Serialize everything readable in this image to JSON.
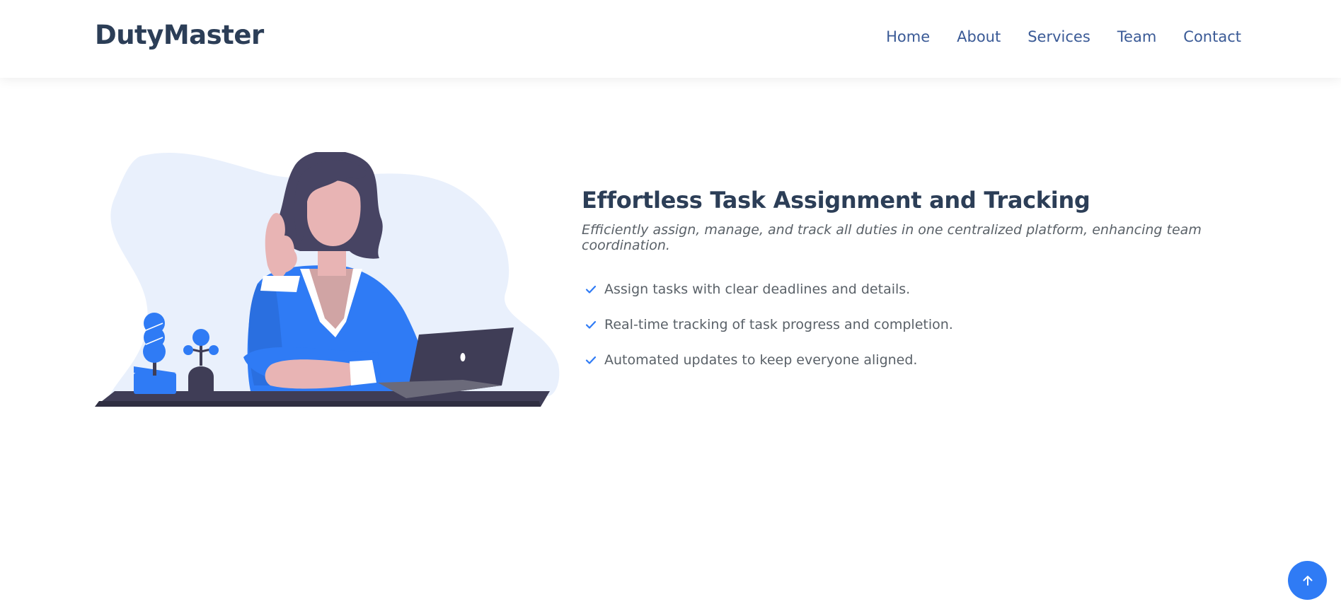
{
  "brand": {
    "name": "DutyMaster"
  },
  "nav": {
    "items": [
      {
        "label": "Home"
      },
      {
        "label": "About"
      },
      {
        "label": "Services"
      },
      {
        "label": "Team"
      },
      {
        "label": "Contact"
      }
    ]
  },
  "feature_section": {
    "title": "Effortless Task Assignment and Tracking",
    "subtitle": "Efficiently assign, manage, and track all duties in one centralized platform, enhancing team coordination.",
    "items": [
      {
        "text": "Assign tasks with clear deadlines and details.",
        "icon": "check-icon"
      },
      {
        "text": "Real-time tracking of task progress and completion.",
        "icon": "check-icon"
      },
      {
        "text": "Automated updates to keep everyone aligned.",
        "icon": "check-icon"
      }
    ]
  },
  "scroll_top": {
    "icon": "arrow-up-icon"
  },
  "colors": {
    "accent": "#2f7bf5",
    "heading": "#2c3e57",
    "nav_text": "#3a5a96",
    "body_text": "#5a6168",
    "blob": "#e9f0fc"
  }
}
